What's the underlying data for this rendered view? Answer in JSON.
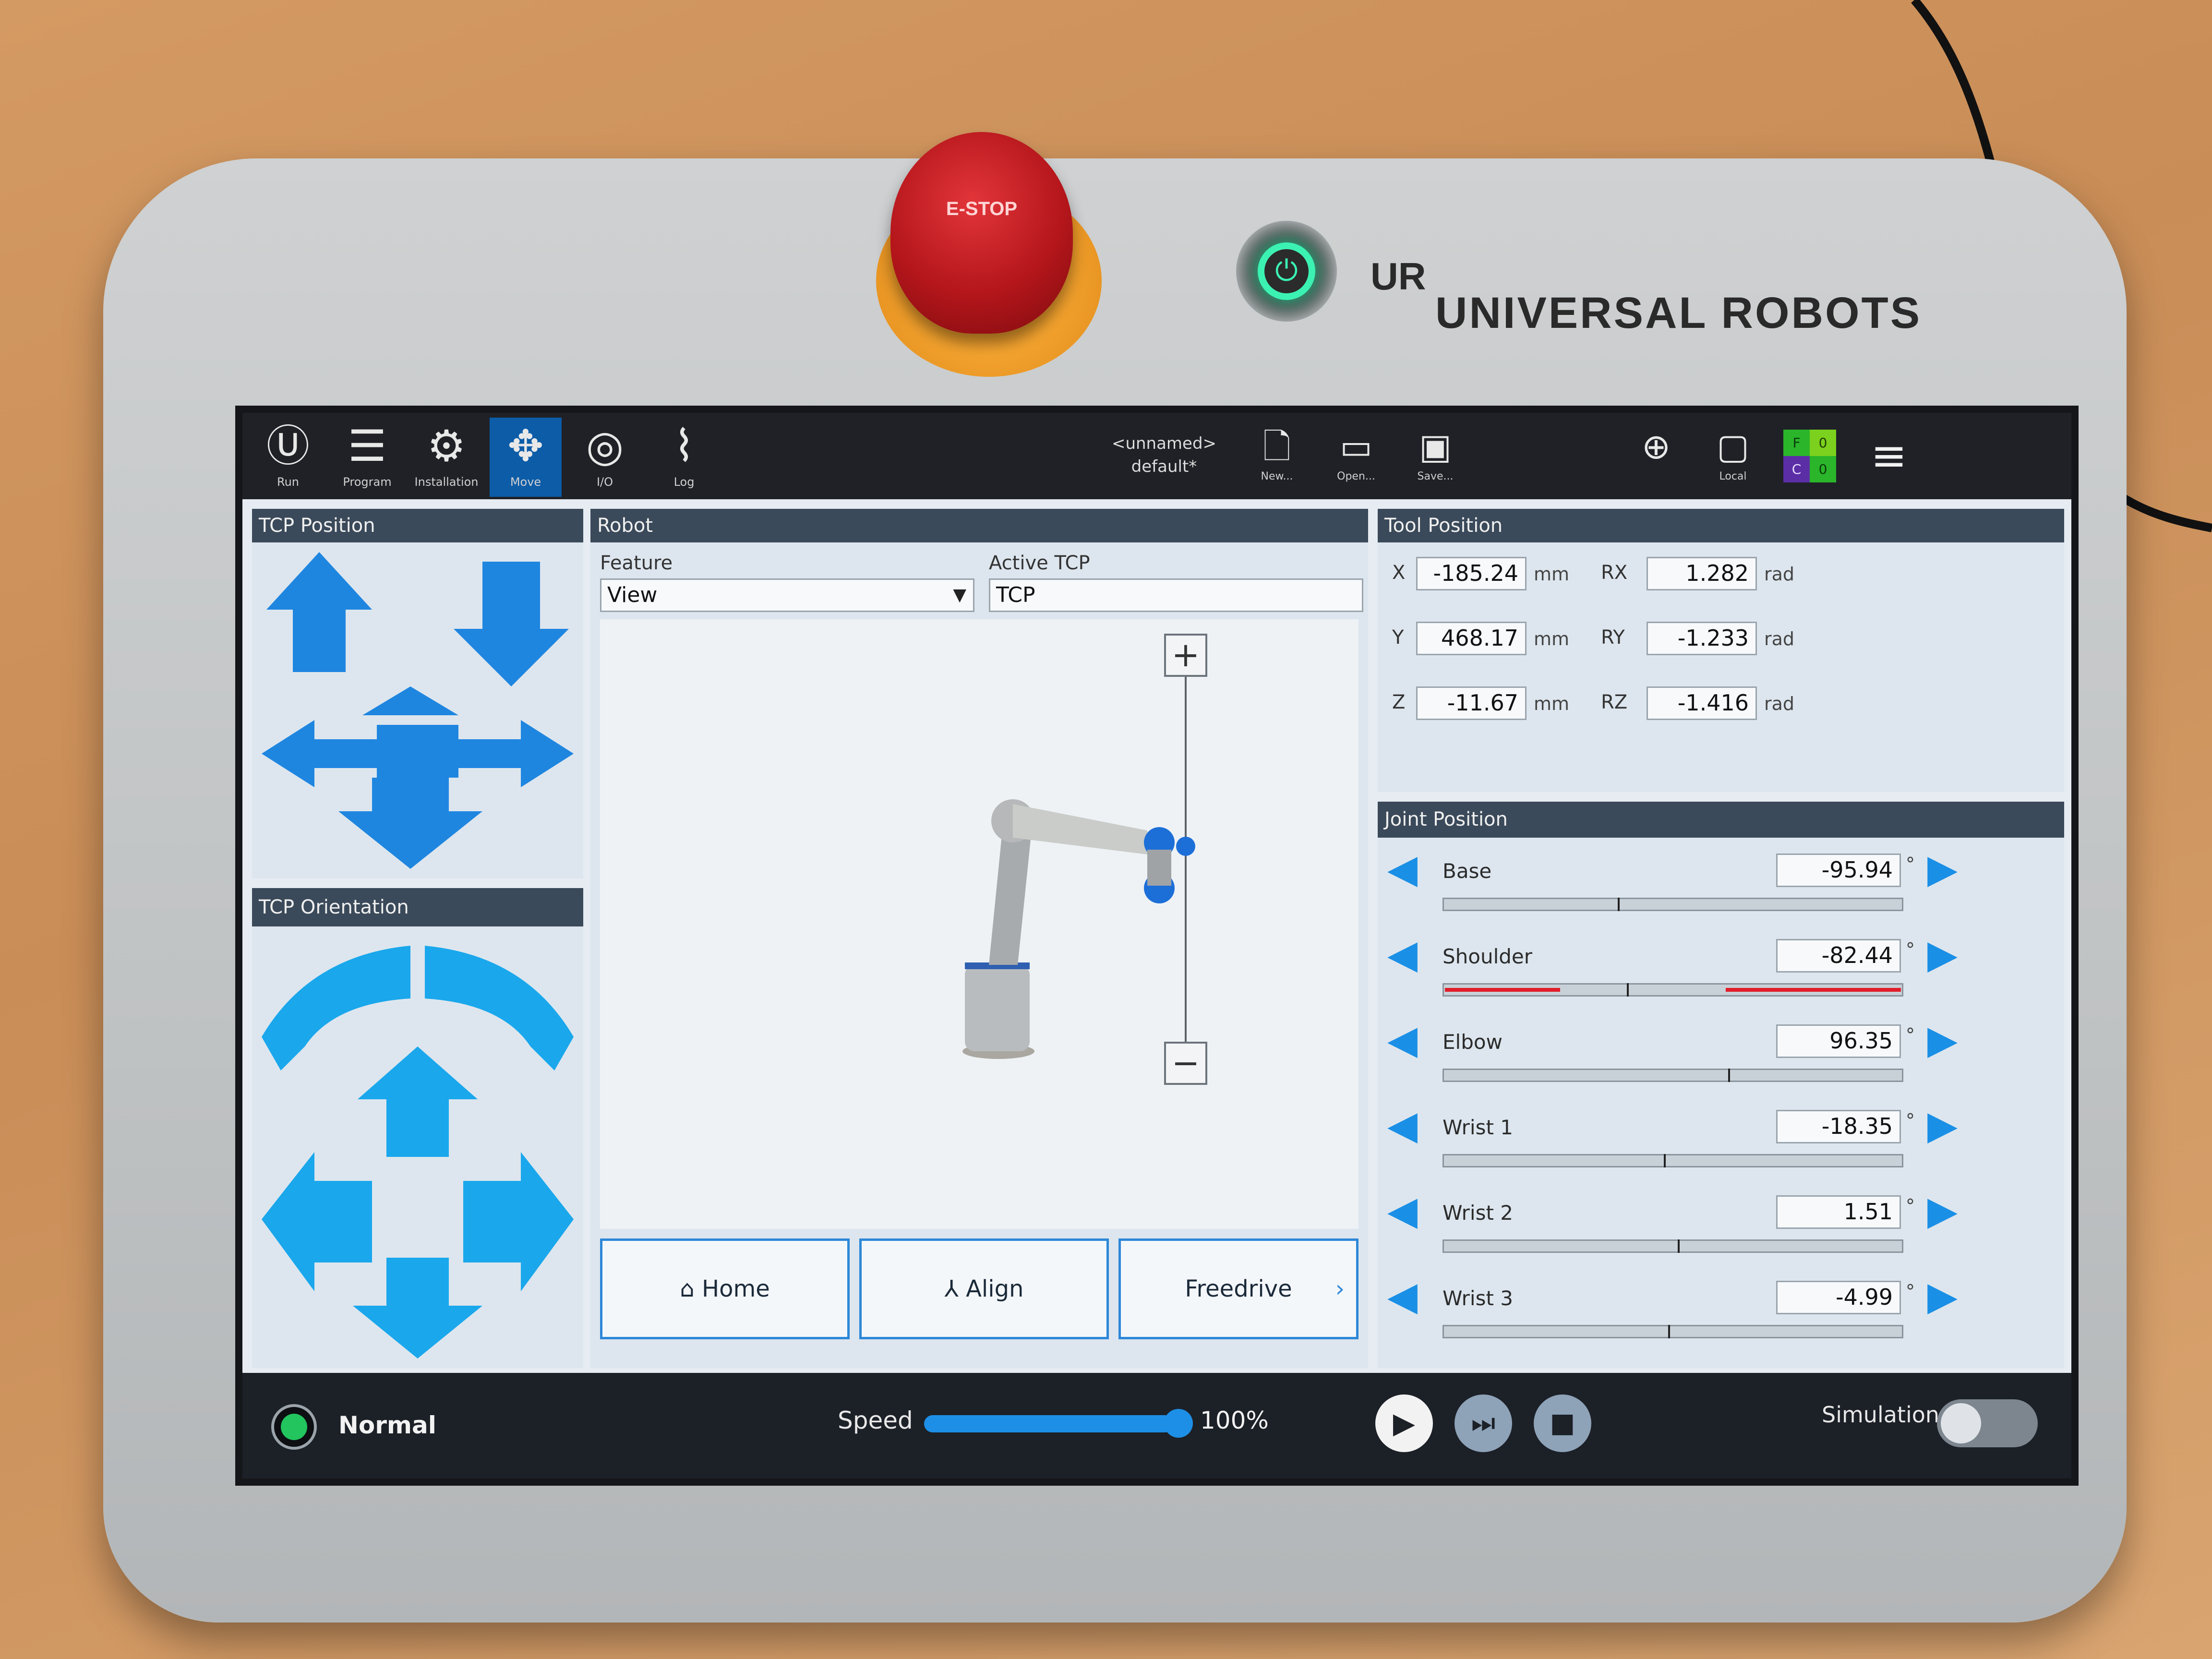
{
  "device": {
    "estop_label": "E-STOP",
    "brand_logo": "UR",
    "brand_name": "UNIVERSAL ROBOTS",
    "power_icon": "power-icon"
  },
  "toolbar": {
    "tabs": [
      {
        "label": "Run",
        "icon": "ur-logo-icon"
      },
      {
        "label": "Program",
        "icon": "program-icon"
      },
      {
        "label": "Installation",
        "icon": "installation-icon"
      },
      {
        "label": "Move",
        "icon": "move-icon",
        "active": true
      },
      {
        "label": "I/O",
        "icon": "io-icon"
      },
      {
        "label": "Log",
        "icon": "log-icon"
      }
    ],
    "program_name": "<unnamed>",
    "installation_name": "default*",
    "file_actions": [
      {
        "label": "New...",
        "icon": "new-file-icon"
      },
      {
        "label": "Open...",
        "icon": "open-folder-icon"
      },
      {
        "label": "Save...",
        "icon": "save-icon"
      }
    ],
    "urplus_icon": "ur-plus-icon",
    "local_label": "Local",
    "fc_indicator": {
      "F": "F",
      "F_val": "0",
      "C": "C",
      "C_val": "0"
    },
    "menu_icon": "hamburger-menu-icon"
  },
  "tcp_position": {
    "title": "TCP Position",
    "icons": [
      "arrow-up-icon",
      "arrow-down-icon",
      "arrow-left-icon",
      "arrow-right-icon",
      "arrow-forward-icon",
      "arrow-back-icon"
    ]
  },
  "tcp_orientation": {
    "title": "TCP Orientation"
  },
  "robot": {
    "title": "Robot",
    "feature_label": "Feature",
    "feature_value": "View",
    "active_tcp_label": "Active TCP",
    "active_tcp_value": "TCP",
    "zoom_in": "+",
    "zoom_out": "−",
    "zoom_level": 0.45,
    "buttons": {
      "home": "Home",
      "align": "Align",
      "freedrive": "Freedrive",
      "freedrive_chevron": "›"
    }
  },
  "tool_position": {
    "title": "Tool Position",
    "rows": [
      {
        "axis": "X",
        "value": "-185.24",
        "unit": "mm",
        "raxis": "RX",
        "rvalue": "1.282",
        "runit": "rad"
      },
      {
        "axis": "Y",
        "value": "468.17",
        "unit": "mm",
        "raxis": "RY",
        "rvalue": "-1.233",
        "runit": "rad"
      },
      {
        "axis": "Z",
        "value": "-11.67",
        "unit": "mm",
        "raxis": "RZ",
        "rvalue": "-1.416",
        "runit": "rad"
      }
    ]
  },
  "joint_position": {
    "title": "Joint Position",
    "degree": "°",
    "joints": [
      {
        "name": "Base",
        "value": "-95.94"
      },
      {
        "name": "Shoulder",
        "value": "-82.44"
      },
      {
        "name": "Elbow",
        "value": "96.35"
      },
      {
        "name": "Wrist 1",
        "value": "-18.35"
      },
      {
        "name": "Wrist 2",
        "value": "1.51"
      },
      {
        "name": "Wrist 3",
        "value": "-4.99"
      }
    ]
  },
  "status_bar": {
    "status": "Normal",
    "status_color": "#22c55e",
    "speed_label": "Speed",
    "speed_value": "100%",
    "speed_fraction": 1.0,
    "simulation_label": "Simulation",
    "simulation_on": false
  }
}
